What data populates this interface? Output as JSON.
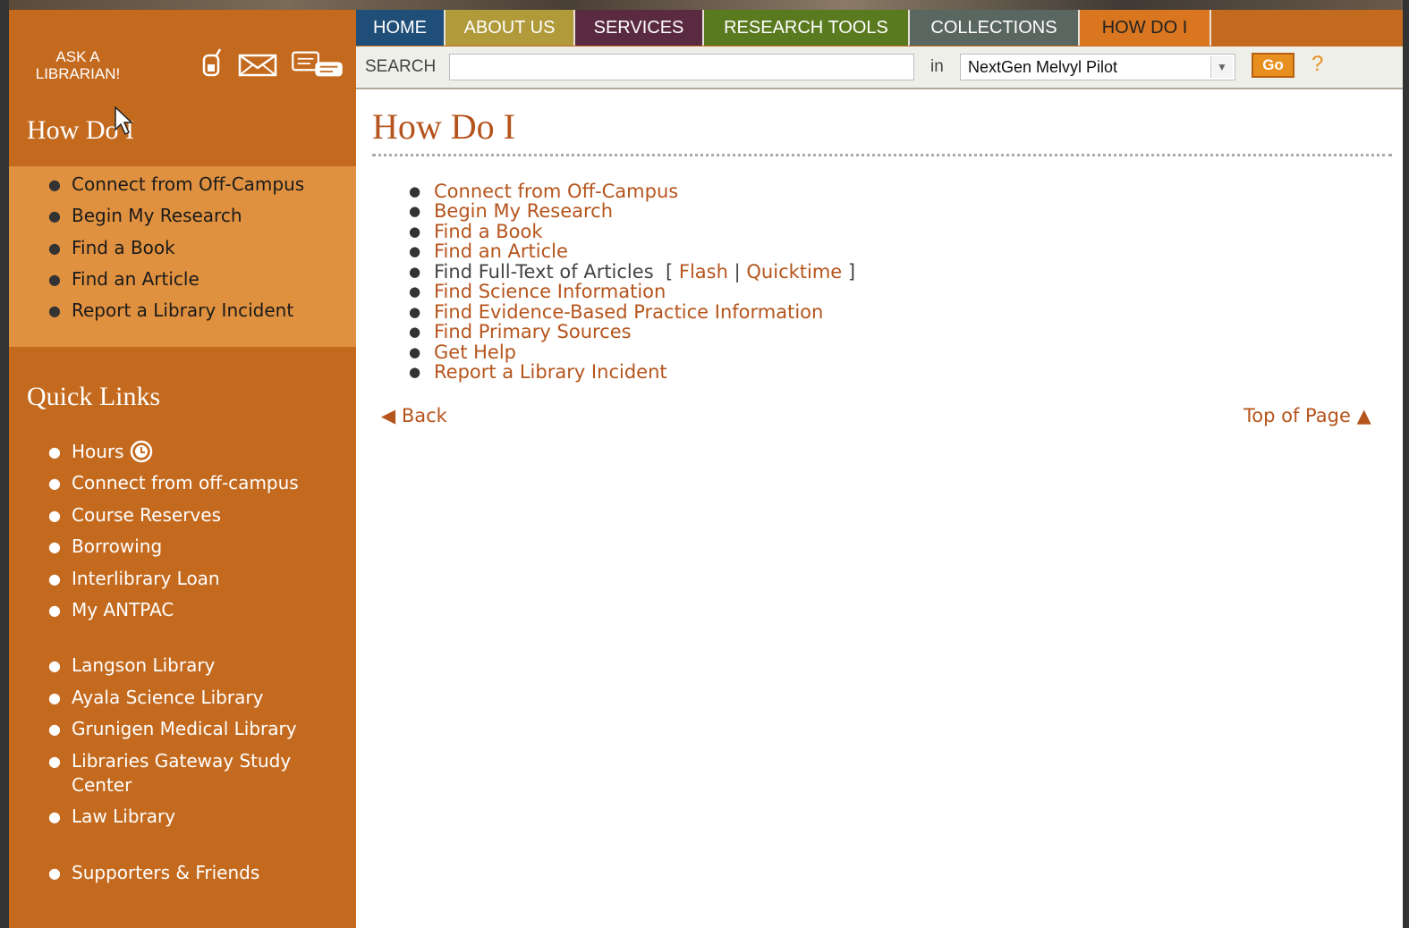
{
  "nav": {
    "tabs": [
      {
        "label": "HOME",
        "color": "#1f4e79"
      },
      {
        "label": "ABOUT US",
        "color": "#b09a3a"
      },
      {
        "label": "SERVICES",
        "color": "#5a2a40"
      },
      {
        "label": "RESEARCH TOOLS",
        "color": "#5a7a1f"
      },
      {
        "label": "COLLECTIONS",
        "color": "#5a6660"
      },
      {
        "label": "HOW DO I",
        "color": "#d9761f"
      }
    ]
  },
  "ask": {
    "label_line1": "ASK A",
    "label_line2": "LIBRARIAN!",
    "icons": [
      "phone-icon",
      "email-icon",
      "chat-icon"
    ]
  },
  "search": {
    "label": "SEARCH",
    "value": "",
    "in_label": "in",
    "scope": "NextGen Melvyl Pilot",
    "go_label": "Go",
    "help_label": "?"
  },
  "sidebar": {
    "howdoi_heading": "How Do I",
    "howdoi_items": [
      "Connect from Off-Campus",
      "Begin My Research",
      "Find a Book",
      "Find an Article",
      "Report a Library Incident"
    ],
    "quick_heading": "Quick Links",
    "quick_items": [
      "Hours",
      "Connect from off-campus",
      "Course Reserves",
      "Borrowing",
      "Interlibrary Loan",
      "My ANTPAC",
      "Langson Library",
      "Ayala Science Library",
      "Grunigen Medical Library",
      "Libraries Gateway Study",
      "Center",
      "Law Library",
      "Supporters & Friends"
    ]
  },
  "main": {
    "title": "How Do I",
    "links": [
      "Connect from Off-Campus",
      "Begin My Research",
      "Find a Book",
      "Find an Article"
    ],
    "fulltext": {
      "label": "Find Full-Text of Articles",
      "open": "[",
      "flash": "Flash",
      "sep": "|",
      "quicktime": "Quicktime",
      "close": "]"
    },
    "links2": [
      "Find Science Information",
      "Find Evidence-Based Practice Information",
      "Find Primary Sources",
      "Get Help",
      "Report a Library Incident"
    ],
    "back_label": "Back",
    "top_label": "Top of Page"
  }
}
